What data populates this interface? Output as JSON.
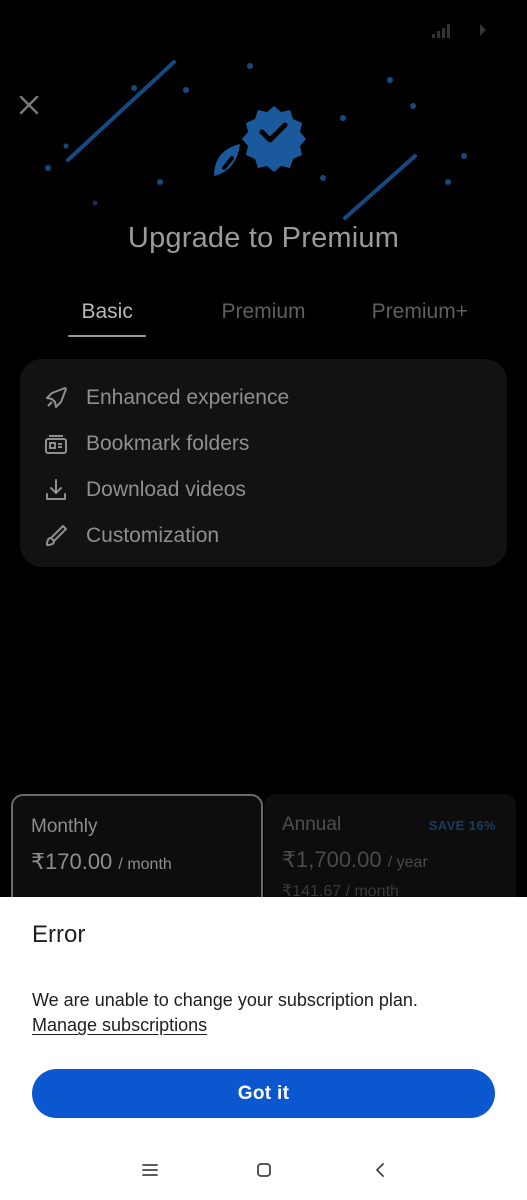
{
  "header": {
    "title": "Upgrade to Premium"
  },
  "tabs": [
    {
      "label": "Basic",
      "active": true
    },
    {
      "label": "Premium",
      "active": false
    },
    {
      "label": "Premium+",
      "active": false
    }
  ],
  "features": [
    {
      "label": "Enhanced experience",
      "icon": "rocket-icon"
    },
    {
      "label": "Bookmark folders",
      "icon": "bookmark-folder-icon"
    },
    {
      "label": "Download videos",
      "icon": "download-icon"
    },
    {
      "label": "Customization",
      "icon": "brush-icon"
    }
  ],
  "plans": {
    "monthly": {
      "name": "Monthly",
      "price": "₹170.00",
      "unit": "/ month"
    },
    "annual": {
      "name": "Annual",
      "price": "₹1,700.00",
      "unit": "/ year",
      "sub": "₹141.67 / month",
      "badge": "SAVE 16%"
    }
  },
  "dialog": {
    "title": "Error",
    "message": "We are unable to change your subscription plan.",
    "link": "Manage subscriptions",
    "button": "Got it"
  },
  "colors": {
    "accent": "#0b57d0",
    "badge": "#1b3a66",
    "art": "#1a5a9c"
  }
}
